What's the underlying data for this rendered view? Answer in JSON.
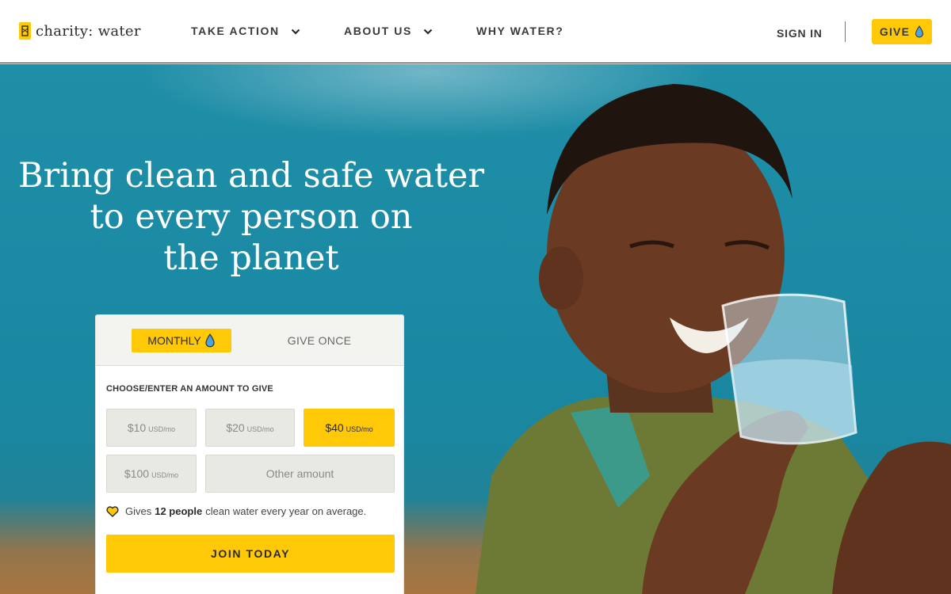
{
  "brand": {
    "name": "charity: water",
    "accent_color": "#ffc907",
    "logo_icon": "jerry-can-icon"
  },
  "nav": {
    "items": [
      {
        "label": "TAKE ACTION",
        "icon": "chevron-down-icon"
      },
      {
        "label": "ABOUT US",
        "icon": "chevron-down-icon"
      },
      {
        "label": "WHY WATER?"
      }
    ],
    "sign_in": "SIGN IN",
    "give": "GIVE",
    "give_icon": "water-drop-icon"
  },
  "hero": {
    "headline_lines": [
      "Bring clean and safe water",
      "to every person on",
      "the planet"
    ],
    "image": "boy-drinking-water-photo"
  },
  "donation": {
    "tabs": [
      {
        "label": "MONTHLY",
        "icon": "water-drop-icon",
        "selected": true
      },
      {
        "label": "GIVE ONCE",
        "selected": false
      }
    ],
    "prompt": "CHOOSE/ENTER AN AMOUNT TO GIVE",
    "amounts": [
      {
        "value": "$10",
        "unit": "USD/mo",
        "selected": false
      },
      {
        "value": "$20",
        "unit": "USD/mo",
        "selected": false
      },
      {
        "value": "$40",
        "unit": "USD/mo",
        "selected": true
      },
      {
        "value": "$100",
        "unit": "USD/mo",
        "selected": false
      }
    ],
    "other_placeholder": "Other amount",
    "impact": {
      "icon": "heart-icon",
      "prefix": "Gives",
      "highlight": "12 people",
      "suffix": "clean water every year on average."
    },
    "cta": "JOIN TODAY"
  }
}
